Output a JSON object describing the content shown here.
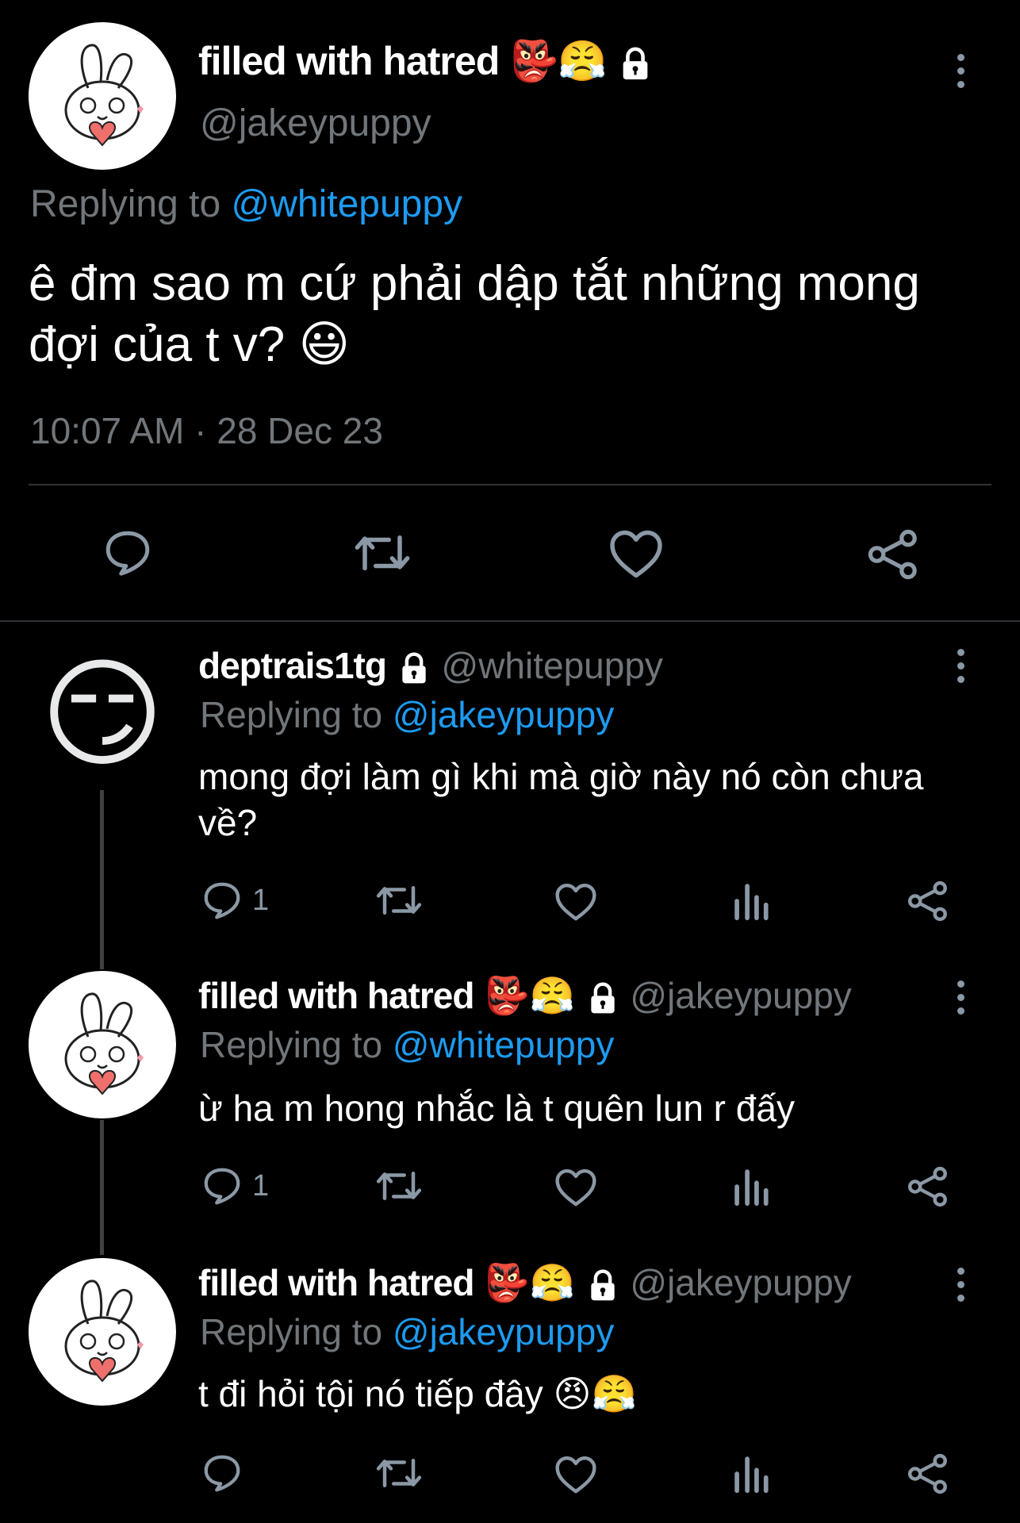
{
  "main_tweet": {
    "display_name": "filled with hatred",
    "name_emojis": "👺😤",
    "handle": "@jakeypuppy",
    "replying_prefix": "Replying to",
    "replying_handle": "@whitepuppy",
    "text": "ê đm sao m cứ phải dập tắt những mong đợi của t v?",
    "text_emoji": "😃",
    "timestamp": "10:07 AM · 28 Dec 23"
  },
  "replies": [
    {
      "display_name": "deptrais1tg",
      "name_emojis": "",
      "handle": "@whitepuppy",
      "replying_prefix": "Replying to",
      "replying_handle": "@jakeypuppy",
      "text": "mong đợi làm gì khi mà giờ này nó còn chưa về?",
      "text_emoji": "",
      "reply_count": "1"
    },
    {
      "display_name": "filled with hatred",
      "name_emojis": "👺😤",
      "handle": "@jakeypuppy",
      "replying_prefix": "Replying to",
      "replying_handle": "@whitepuppy",
      "text": "ừ ha m hong nhắc là t quên lun r đấy",
      "text_emoji": "",
      "reply_count": "1"
    },
    {
      "display_name": "filled with hatred",
      "name_emojis": "👺😤",
      "handle": "@jakeypuppy",
      "replying_prefix": "Replying to",
      "replying_handle": "@jakeypuppy",
      "text": "t đi hỏi tội nó tiếp đây",
      "text_emoji": "😠😤",
      "reply_count": ""
    }
  ],
  "avatar_emoji": "😏",
  "colors": {
    "link": "#1d9bf0",
    "muted": "#71767b",
    "background": "#000000"
  }
}
